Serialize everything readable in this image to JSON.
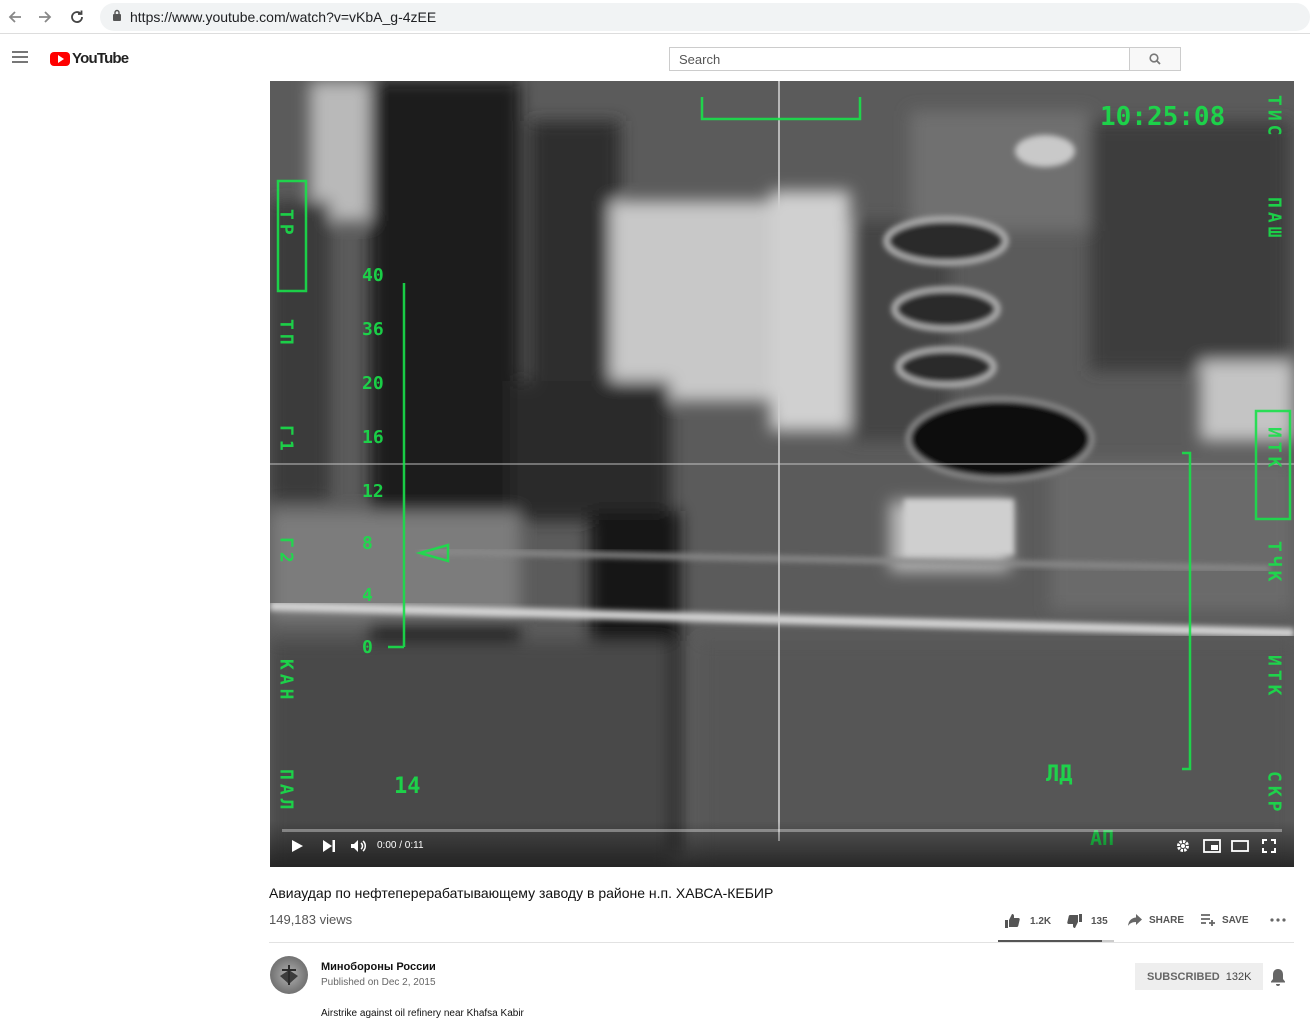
{
  "browser": {
    "url": "https://www.youtube.com/watch?v=vKbA_g-4zEE"
  },
  "header": {
    "logo_text": "YouTube",
    "search_placeholder": "Search"
  },
  "player": {
    "time": "0:00 / 0:11",
    "progress_fraction": 0.0,
    "hud": {
      "clock": "10:25:08",
      "scale_labels": [
        "40",
        "36",
        "20",
        "16",
        "12",
        "8",
        "4",
        "0"
      ],
      "left_labels": [
        "ТР",
        "ТП",
        "Г1",
        "Г2",
        "КАН",
        "ПАЛ"
      ],
      "right_labels": [
        "ТИС",
        "ПАШ",
        "ИТК",
        "ТЧК",
        "ИТК",
        "СКР"
      ],
      "bottom_labels": [
        "14",
        "ЛД",
        "АП"
      ],
      "accent_color": "#19e04a"
    }
  },
  "video": {
    "title": "Авиаудар по нефтеперерабатывающему заводу в районе н.п. ХАВСА-КЕБИР",
    "views": "149,183 views",
    "likes": "1.2K",
    "dislikes": "135",
    "share_label": "SHARE",
    "save_label": "SAVE"
  },
  "channel": {
    "name": "Минобороны России",
    "published": "Published on Dec 2, 2015",
    "subscribe_label": "SUBSCRIBED",
    "subscriber_count": "132K",
    "description": "Airstrike against oil refinery near Khafsa Kabir"
  }
}
